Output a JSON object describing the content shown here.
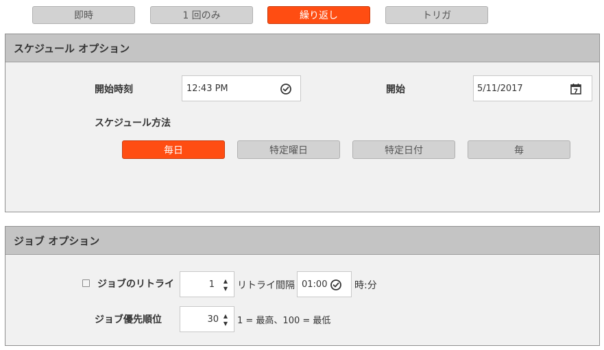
{
  "mode_tabs": [
    {
      "label": "即時",
      "active": false
    },
    {
      "label": "1 回のみ",
      "active": false
    },
    {
      "label": "繰り返し",
      "active": true
    },
    {
      "label": "トリガ",
      "active": false
    }
  ],
  "schedule_options": {
    "title": "スケジュール オプション",
    "start_time_label": "開始時刻",
    "start_time_value": "12:43 PM",
    "start_date_label": "開始",
    "start_date_value": "5/11/2017",
    "calendar_day": "7",
    "method_label": "スケジュール方法",
    "methods": [
      {
        "label": "毎日",
        "active": true
      },
      {
        "label": "特定曜日",
        "active": false
      },
      {
        "label": "特定日付",
        "active": false
      },
      {
        "label": "毎",
        "active": false
      }
    ]
  },
  "job_options": {
    "title": "ジョブ オプション",
    "retry_label": "ジョブのリトライ",
    "retry_checked": false,
    "retry_count": "1",
    "retry_interval_label": "リトライ間隔",
    "retry_interval_value": "01:00",
    "retry_interval_unit": "時:分",
    "priority_label": "ジョブ優先順位",
    "priority_value": "30",
    "priority_hint": "1 = 最高、100 = 最低"
  },
  "colors": {
    "accent": "#ff4d12",
    "panel_bg": "#f1f1f1",
    "panel_header": "#c4c4c4",
    "button_bg": "#d2d2d2"
  },
  "icons": {
    "time": "clock-check-icon",
    "date": "calendar-icon",
    "spinner": "spinner-arrows-icon"
  }
}
